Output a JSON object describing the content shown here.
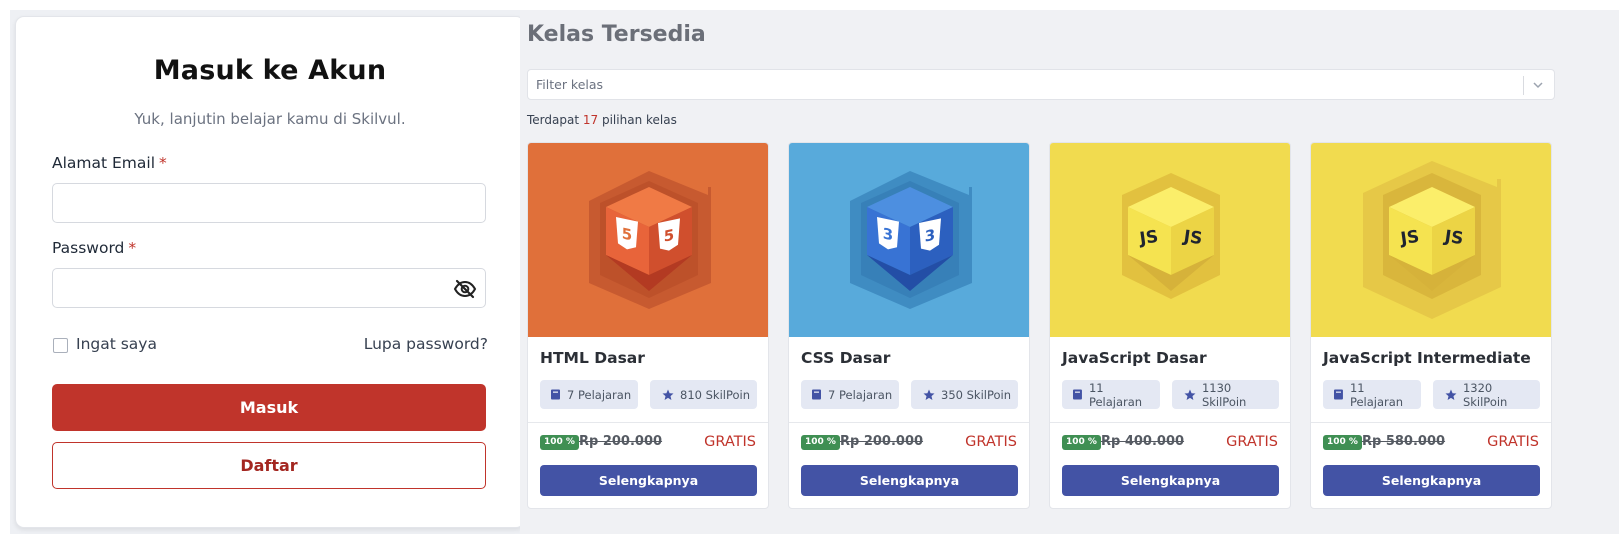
{
  "login": {
    "title": "Masuk ke Akun",
    "subtitle": "Yuk, lanjutin belajar kamu di Skilvul.",
    "email_label": "Alamat Email",
    "password_label": "Password",
    "required_mark": "*",
    "email_value": "",
    "password_value": "",
    "remember_label": "Ingat saya",
    "forgot_label": "Lupa password?",
    "login_button": "Masuk",
    "register_button": "Daftar",
    "password_toggle_icon": "eye-off-icon"
  },
  "catalog": {
    "title": "Kelas Tersedia",
    "filter_placeholder": "Filter kelas",
    "count_prefix": "Terdapat",
    "count_value": "17",
    "count_suffix": "pilihan kelas",
    "courses": [
      {
        "name": "HTML Dasar",
        "lessons": "7 Pelajaran",
        "points": "810 SkilPoin",
        "discount": "100 %",
        "old_price": "Rp 200.000",
        "price": "GRATIS",
        "button": "Selengkapnya",
        "image_icon": "html5-cube-icon"
      },
      {
        "name": "CSS Dasar",
        "lessons": "7 Pelajaran",
        "points": "350 SkilPoin",
        "discount": "100 %",
        "old_price": "Rp 200.000",
        "price": "GRATIS",
        "button": "Selengkapnya",
        "image_icon": "css3-cube-icon"
      },
      {
        "name": "JavaScript Dasar",
        "lessons": "11 Pelajaran",
        "points": "1130 SkilPoin",
        "discount": "100 %",
        "old_price": "Rp 400.000",
        "price": "GRATIS",
        "button": "Selengkapnya",
        "image_icon": "js-cube-icon"
      },
      {
        "name": "JavaScript Intermediate",
        "lessons": "11 Pelajaran",
        "points": "1320 SkilPoin",
        "discount": "100 %",
        "old_price": "Rp 580.000",
        "price": "GRATIS",
        "button": "Selengkapnya",
        "image_icon": "js-cube-icon"
      }
    ]
  },
  "colors": {
    "primary_red": "#c0342b",
    "primary_blue": "#4353a5",
    "discount_green": "#3f8f53",
    "html_bg": "#e0703a",
    "css_bg": "#58aadb",
    "js_bg": "#f1db4f"
  }
}
